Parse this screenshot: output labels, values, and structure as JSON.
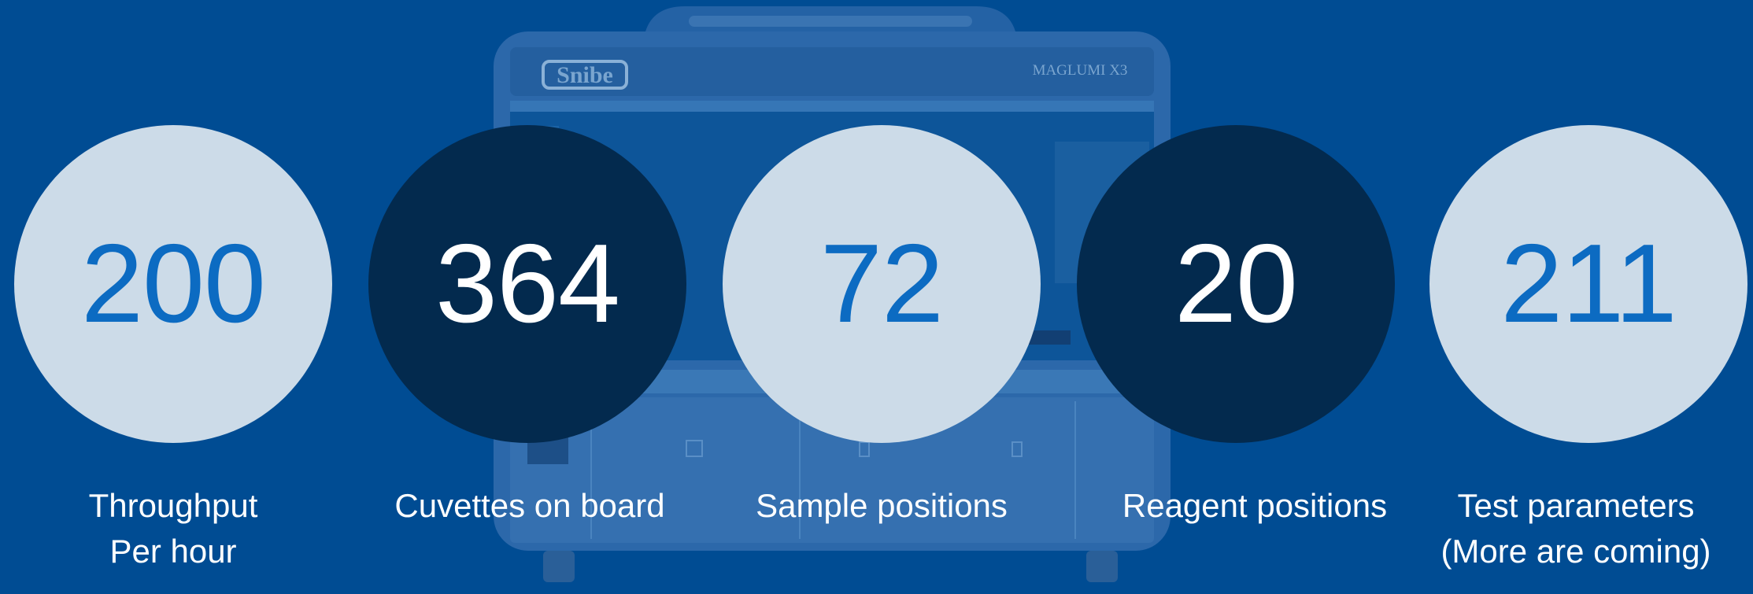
{
  "background": {
    "color": "#004c93",
    "machine": {
      "brand": "Snibe",
      "model": "MAGLUMI X3"
    }
  },
  "colors": {
    "light_circle": "#ccdbe8",
    "dark_circle": "#032a4e",
    "light_number": "#0c6bc2",
    "dark_number": "#ffffff",
    "label": "#ffffff"
  },
  "stats": [
    {
      "value": "200",
      "label_line1": "Throughput",
      "label_line2": "Per hour",
      "style": "light"
    },
    {
      "value": "364",
      "label_line1": "Cuvettes on board",
      "label_line2": "",
      "style": "dark"
    },
    {
      "value": "72",
      "label_line1": "Sample positions",
      "label_line2": "",
      "style": "light"
    },
    {
      "value": "20",
      "label_line1": "Reagent positions",
      "label_line2": "",
      "style": "dark"
    },
    {
      "value": "211",
      "label_line1": "Test parameters",
      "label_line2": "(More are coming)",
      "style": "light"
    }
  ]
}
